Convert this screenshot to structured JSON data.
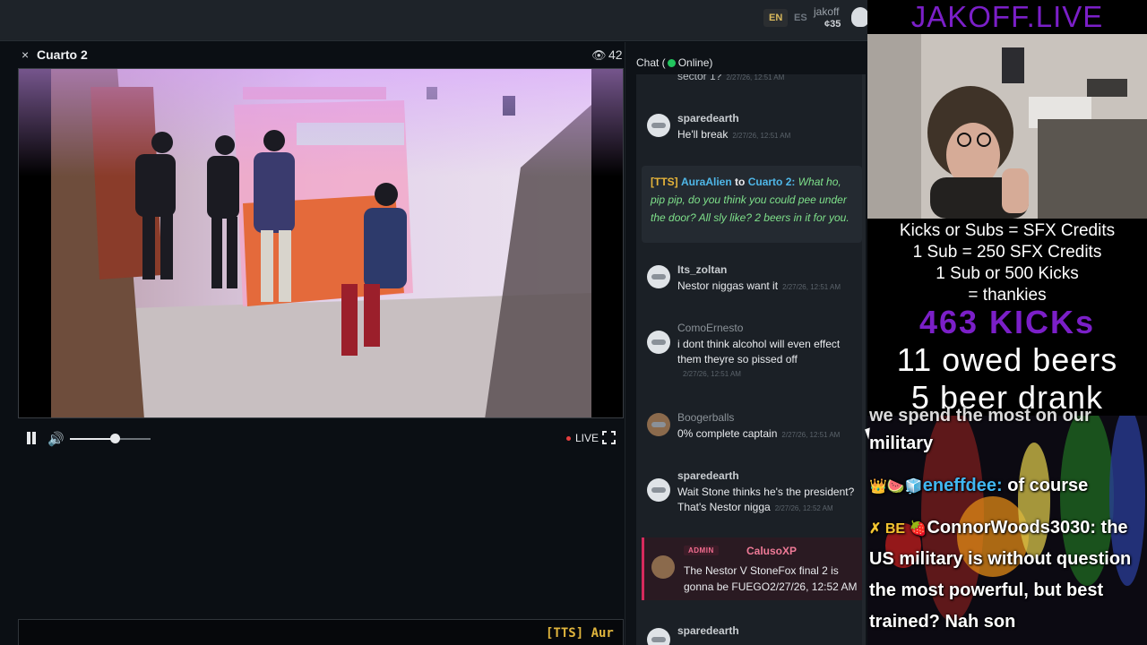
{
  "topbar": {
    "languages": [
      "EN",
      "ES"
    ],
    "active_language": "EN",
    "username": "jakoff",
    "coins": "¢35"
  },
  "room": {
    "close_glyph": "×",
    "title": "Cuarto 2",
    "viewers": "42",
    "viewer_icon": "eye-icon"
  },
  "player": {
    "live_label": "LIVE",
    "volume_level": 0.55,
    "state": "playing",
    "live_dot_color": "#e53e3e"
  },
  "ticker": {
    "text": "[TTS] Aur"
  },
  "chat": {
    "title": "Chat (",
    "status": "Online)",
    "status_color": "#22c55e",
    "messages": [
      {
        "user": "",
        "text": "sector 1?",
        "time": "2/27/26, 12:51 AM"
      },
      {
        "user": "sparedearth",
        "text": "He'll break",
        "time": "2/27/26, 12:51 AM"
      },
      {
        "tts_tag": "[TTS]",
        "user": "AuraAlien",
        "to_word": "to",
        "target": "Cuarto 2:",
        "text": "What ho, pip pip, do you think you could pee under the door? All sly like? 2 beers in it for you."
      },
      {
        "user": "Its_zoltan",
        "text": "Nestor niggas want it",
        "time": "2/27/26, 12:51 AM"
      },
      {
        "user": "ComoErnesto",
        "text": "i dont think alcohol will even effect them theyre so pissed off",
        "time": "2/27/26, 12:51 AM"
      },
      {
        "user": "Boogerballs",
        "text": "0% complete captain",
        "time": "2/27/26, 12:51 AM"
      },
      {
        "user": "sparedearth",
        "text": "Wait Stone thinks he's the president? That's Nestor nigga",
        "time": "2/27/26, 12:52 AM"
      },
      {
        "badge": "ADMIN",
        "user": "CalusoXP",
        "text": "The Nestor V StoneFox final 2 is gonna be FUEGO",
        "time": "2/27/26, 12:52 AM"
      },
      {
        "user": "sparedearth",
        "text": "",
        "time": ""
      }
    ]
  },
  "stream_overlay": {
    "brand": "JAKOFF.LIVE",
    "credits": [
      "Kicks or Subs = SFX Credits",
      "1 Sub = 250 SFX Credits",
      "1 Sub or 500 Kicks",
      "= thankies"
    ],
    "kicks": "463 KICKs",
    "owed_beers": "11 owed beers",
    "beer_drank": "5 beer drank",
    "chat_lines": [
      {
        "text": "we spend the most on our"
      },
      {
        "text": "military"
      },
      {
        "icons": "👑🍉🧊",
        "name": "eneffdee:",
        "text": " of course"
      },
      {
        "icons": "✗ BE 🍓",
        "name": "ConnorWoods3030:",
        "text": " the"
      },
      {
        "text": "US military is without question"
      },
      {
        "text": "the most powerful, but best"
      },
      {
        "text": "trained? Nah son"
      }
    ]
  }
}
